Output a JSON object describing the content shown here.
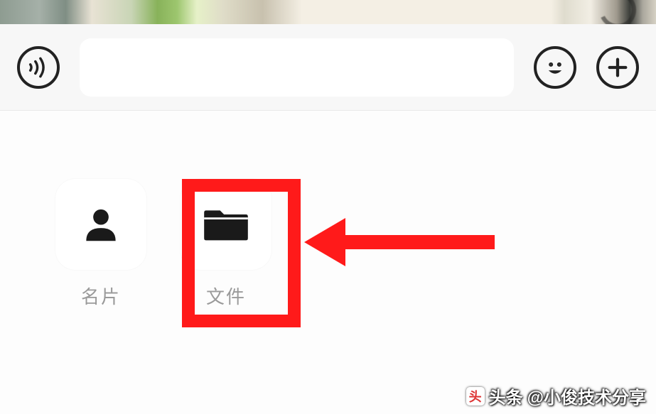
{
  "colors": {
    "highlight": "#ff1a1a",
    "icon_dark": "#1a1a1a",
    "label_gray": "#9a9a9a"
  },
  "input_bar": {
    "voice_button_name": "voice-input-button",
    "text_value": "",
    "text_placeholder": "",
    "emoji_button_name": "emoji-button",
    "more_button_name": "more-attachments-button"
  },
  "attachments": [
    {
      "key": "contact-card",
      "label": "名片",
      "icon": "person-icon",
      "highlighted": false
    },
    {
      "key": "file",
      "label": "文件",
      "icon": "folder-icon",
      "highlighted": true
    }
  ],
  "annotation": {
    "highlighted_key": "file",
    "arrow_direction": "left"
  },
  "watermark": {
    "prefix": "头条",
    "handle": "@小俊技术分享",
    "logo_glyph": "头"
  }
}
